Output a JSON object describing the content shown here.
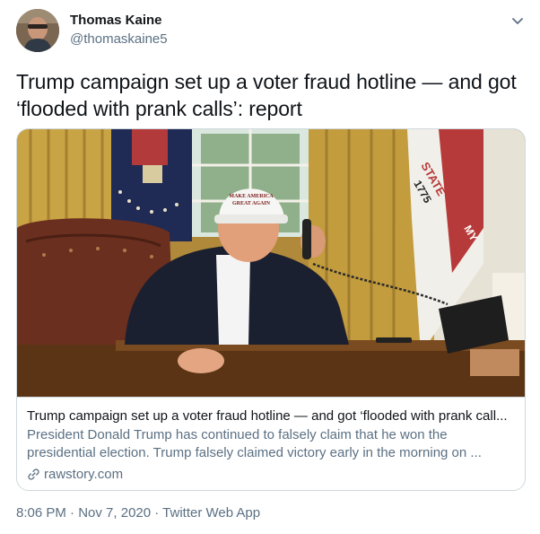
{
  "author": {
    "name": "Thomas Kaine",
    "handle": "@thomaskaine5"
  },
  "tweet": {
    "text": "Trump campaign set up a voter fraud hotline — and got ‘flooded with prank calls’: report"
  },
  "card": {
    "image_hat_text_line1": "MAKE AMERICA",
    "image_hat_text_line2": "GREAT AGAIN",
    "image_flag_text_1": "STATE",
    "image_flag_text_2": "1775",
    "image_flag_text_3": "MY",
    "title": "Trump campaign set up a voter fraud hotline — and got ‘flooded with prank call...",
    "description": "President Donald Trump has continued to falsely claim that he won the presidential election. Trump falsely claimed victory early in the morning on ...",
    "domain": "rawstory.com"
  },
  "meta": {
    "time": "8:06 PM",
    "separator1": " · ",
    "date": "Nov 7, 2020",
    "separator2": " · ",
    "source": "Twitter Web App"
  },
  "colors": {
    "text": "#0f1419",
    "secondary": "#5b7083",
    "border": "#cfd9de"
  },
  "icons": {
    "caret": "chevron-down-icon",
    "link": "link-icon"
  }
}
